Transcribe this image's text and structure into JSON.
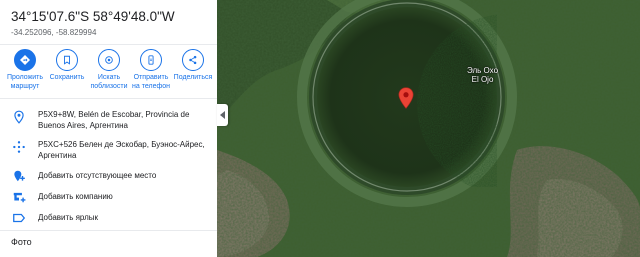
{
  "place": {
    "title": "34°15'07.6\"S 58°49'48.0\"W",
    "decimal": "-34.252096, -58.829994"
  },
  "actions": [
    {
      "label": "Проложить маршрут",
      "icon": "directions-icon"
    },
    {
      "label": "Сохранить",
      "icon": "bookmark-icon"
    },
    {
      "label": "Искать поблизости",
      "icon": "nearby-icon"
    },
    {
      "label": "Отправить на телефон",
      "icon": "send-to-phone-icon"
    },
    {
      "label": "Поделиться",
      "icon": "share-icon"
    }
  ],
  "details": {
    "address": "P5X9+8W, Belén de Escobar, Provincia de Buenos Aires, Аргентина",
    "plus_code": "P5XC+526 Белен де Эскобар, Буэнос-Айрес, Аргентина",
    "add_place": "Добавить отсутствующее место",
    "add_business": "Добавить компанию",
    "add_label": "Добавить ярлык"
  },
  "photos_heading": "Фото",
  "map": {
    "label_line1": "Эль Охо",
    "label_line2": "El Ojo"
  },
  "colors": {
    "accent": "#1a73e8",
    "pin": "#ea4335"
  }
}
